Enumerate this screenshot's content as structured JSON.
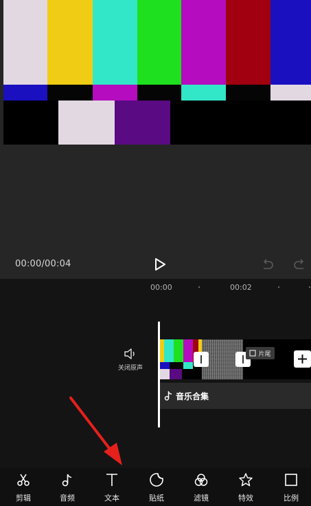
{
  "preview": {
    "time_display": "00:00/00:04"
  },
  "timeline": {
    "ruler": [
      "00:00",
      "00:02"
    ],
    "mute_label": "关闭原声",
    "outro_label": "片尾",
    "music_label": "音乐合集"
  },
  "toolbar": [
    {
      "label": "剪辑",
      "icon": "scissors-icon"
    },
    {
      "label": "音频",
      "icon": "music-note-icon"
    },
    {
      "label": "文本",
      "icon": "text-icon"
    },
    {
      "label": "贴纸",
      "icon": "sticker-icon"
    },
    {
      "label": "滤镜",
      "icon": "filter-icon"
    },
    {
      "label": "特效",
      "icon": "effects-star-icon"
    },
    {
      "label": "比例",
      "icon": "ratio-square-icon"
    }
  ],
  "colors": {
    "background": "#101010",
    "preview_bg": "#262626",
    "arrow": "#e6201c",
    "color_bars": [
      "#e2d8e2",
      "#f0cd14",
      "#32e6c8",
      "#1ee01e",
      "#b40cbe",
      "#a00010",
      "#1a10c0"
    ]
  }
}
